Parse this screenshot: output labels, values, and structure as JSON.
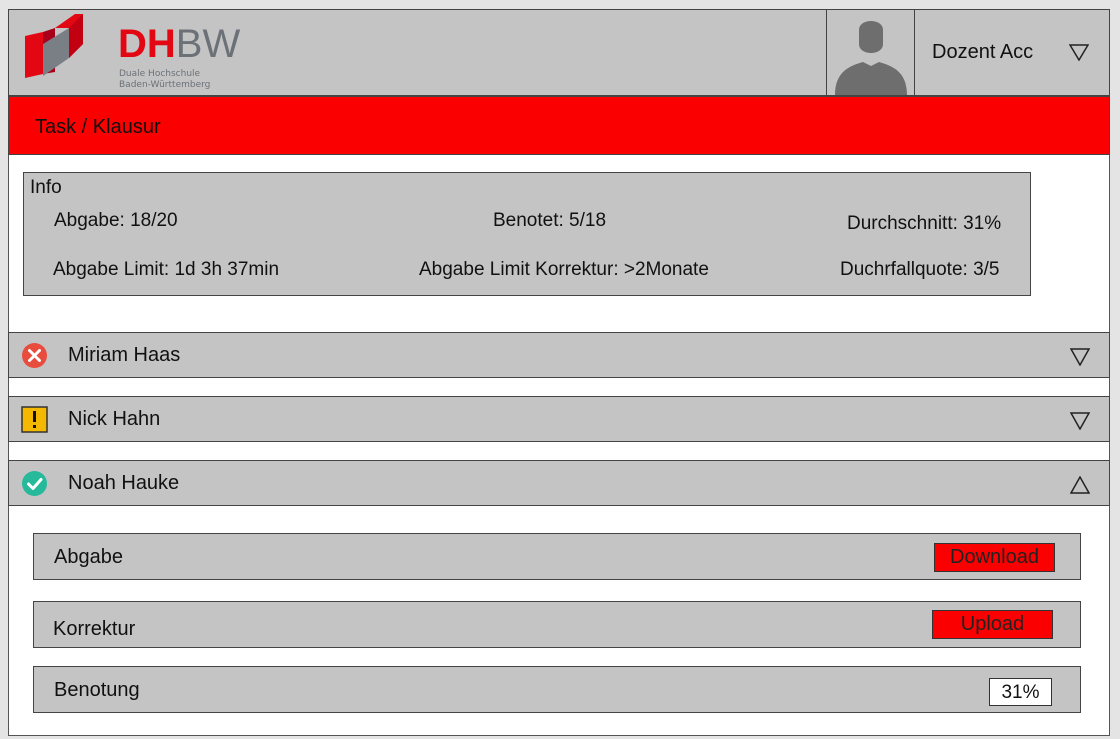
{
  "header": {
    "logo": {
      "brand_red": "DH",
      "brand_grey": "BW",
      "subtitle_line1": "Duale Hochschule",
      "subtitle_line2": "Baden-Württemberg"
    },
    "account_label": "Dozent Acc"
  },
  "title": "Task / Klausur",
  "info": {
    "title": "Info",
    "abgabe": "Abgabe: 18/20",
    "benotet": "Benotet: 5/18",
    "durchschnitt": "Durchschnitt: 31%",
    "abgabe_limit": "Abgabe Limit: 1d 3h 37min",
    "abgabe_limit_korrektur": "Abgabe Limit Korrektur: >2Monate",
    "durchfallquote": "Duchrfallquote: 3/5"
  },
  "students": [
    {
      "name": "Miriam Haas",
      "status": "failed",
      "status_icon": "error-circle-icon",
      "expanded": false
    },
    {
      "name": "Nick Hahn",
      "status": "warning",
      "status_icon": "warning-icon",
      "expanded": false
    },
    {
      "name": "Noah Hauke",
      "status": "passed",
      "status_icon": "check-circle-icon",
      "expanded": true
    }
  ],
  "details": {
    "abgabe_label": "Abgabe",
    "download_label": "Download",
    "korrektur_label": "Korrektur",
    "upload_label": "Upload",
    "benotung_label": "Benotung",
    "benotung_value": "31%"
  },
  "colors": {
    "accent_red": "#fb0000",
    "panel_grey": "#c4c4c4",
    "error": "#e74c3c",
    "warning": "#f5b800",
    "success": "#26b99a"
  }
}
